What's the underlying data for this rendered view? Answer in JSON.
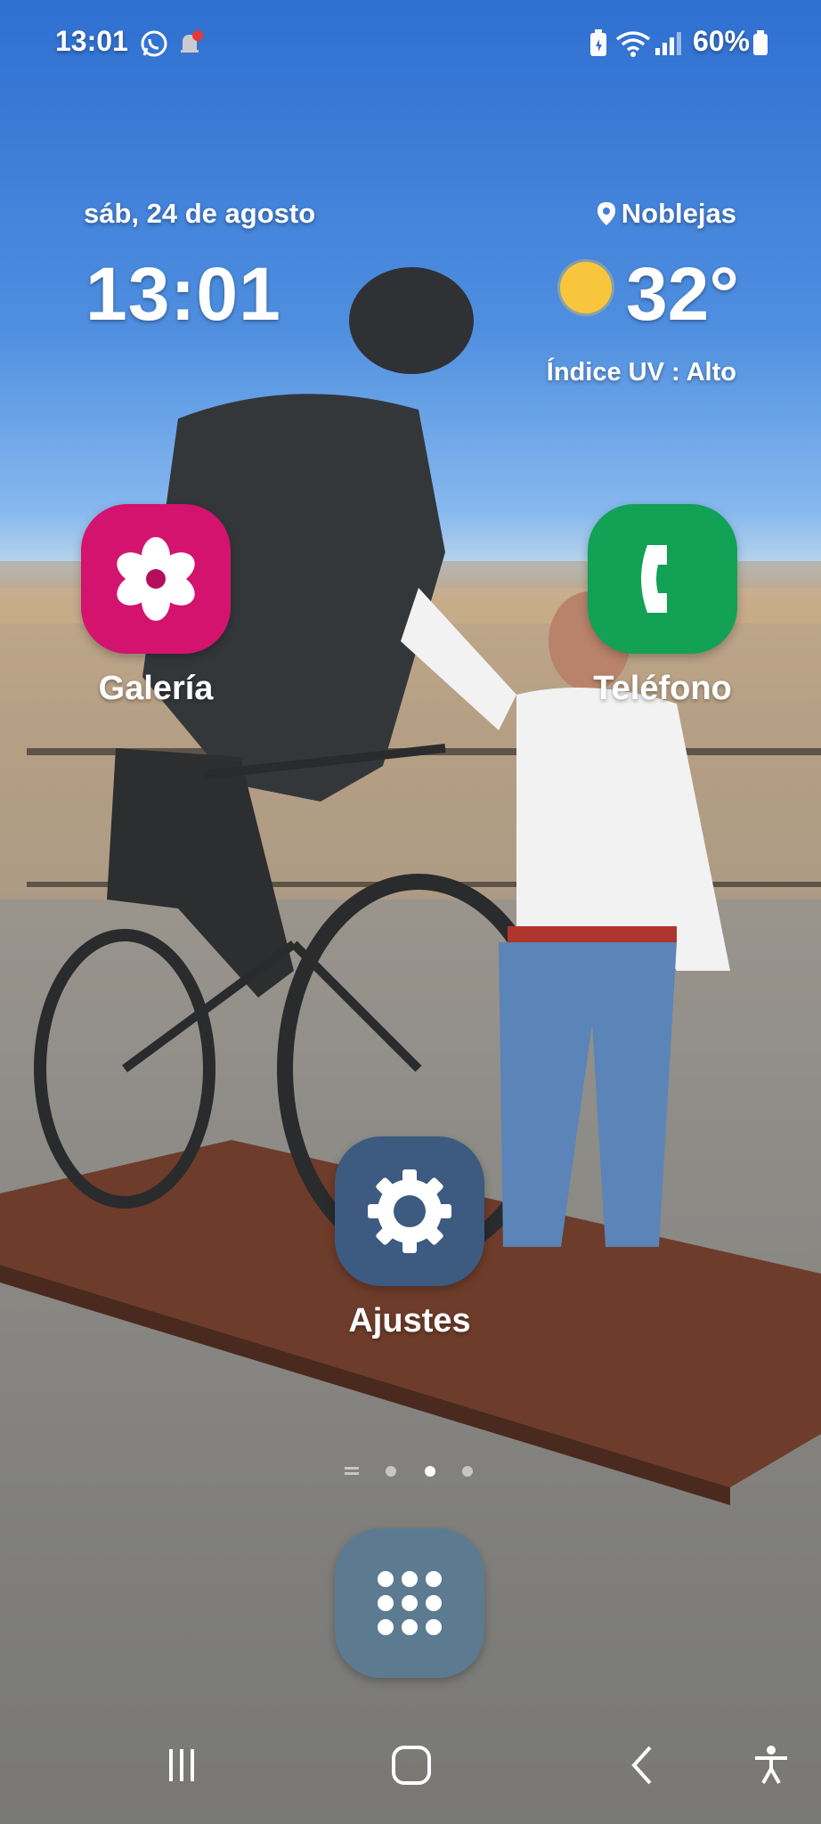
{
  "status_bar": {
    "time": "13:01",
    "notifications": [
      "whatsapp-icon",
      "bell-icon"
    ],
    "right_icons": [
      "battery-saver-icon",
      "wifi-icon",
      "signal-icon"
    ],
    "battery_percent": "60%"
  },
  "widget": {
    "date": "sáb, 24 de agosto",
    "time": "13:01",
    "location": "Noblejas",
    "temperature": "32°",
    "weather_icon": "sun-icon",
    "uv_index": "Índice UV : Alto"
  },
  "apps": [
    {
      "label": "Galería",
      "icon": "gallery-icon",
      "color": "#d3136e"
    },
    {
      "label": "Teléfono",
      "icon": "phone-icon",
      "color": "#12a155"
    },
    {
      "label": "Ajustes",
      "icon": "settings-icon",
      "color": "#3d5a80"
    }
  ],
  "app_drawer": {
    "icon": "app-drawer-icon",
    "color": "#5d7b90"
  },
  "page_indicator": {
    "pages": 2,
    "current": 2
  },
  "nav_bar": {
    "buttons": [
      "recents-icon",
      "home-icon",
      "back-icon",
      "accessibility-icon"
    ]
  }
}
